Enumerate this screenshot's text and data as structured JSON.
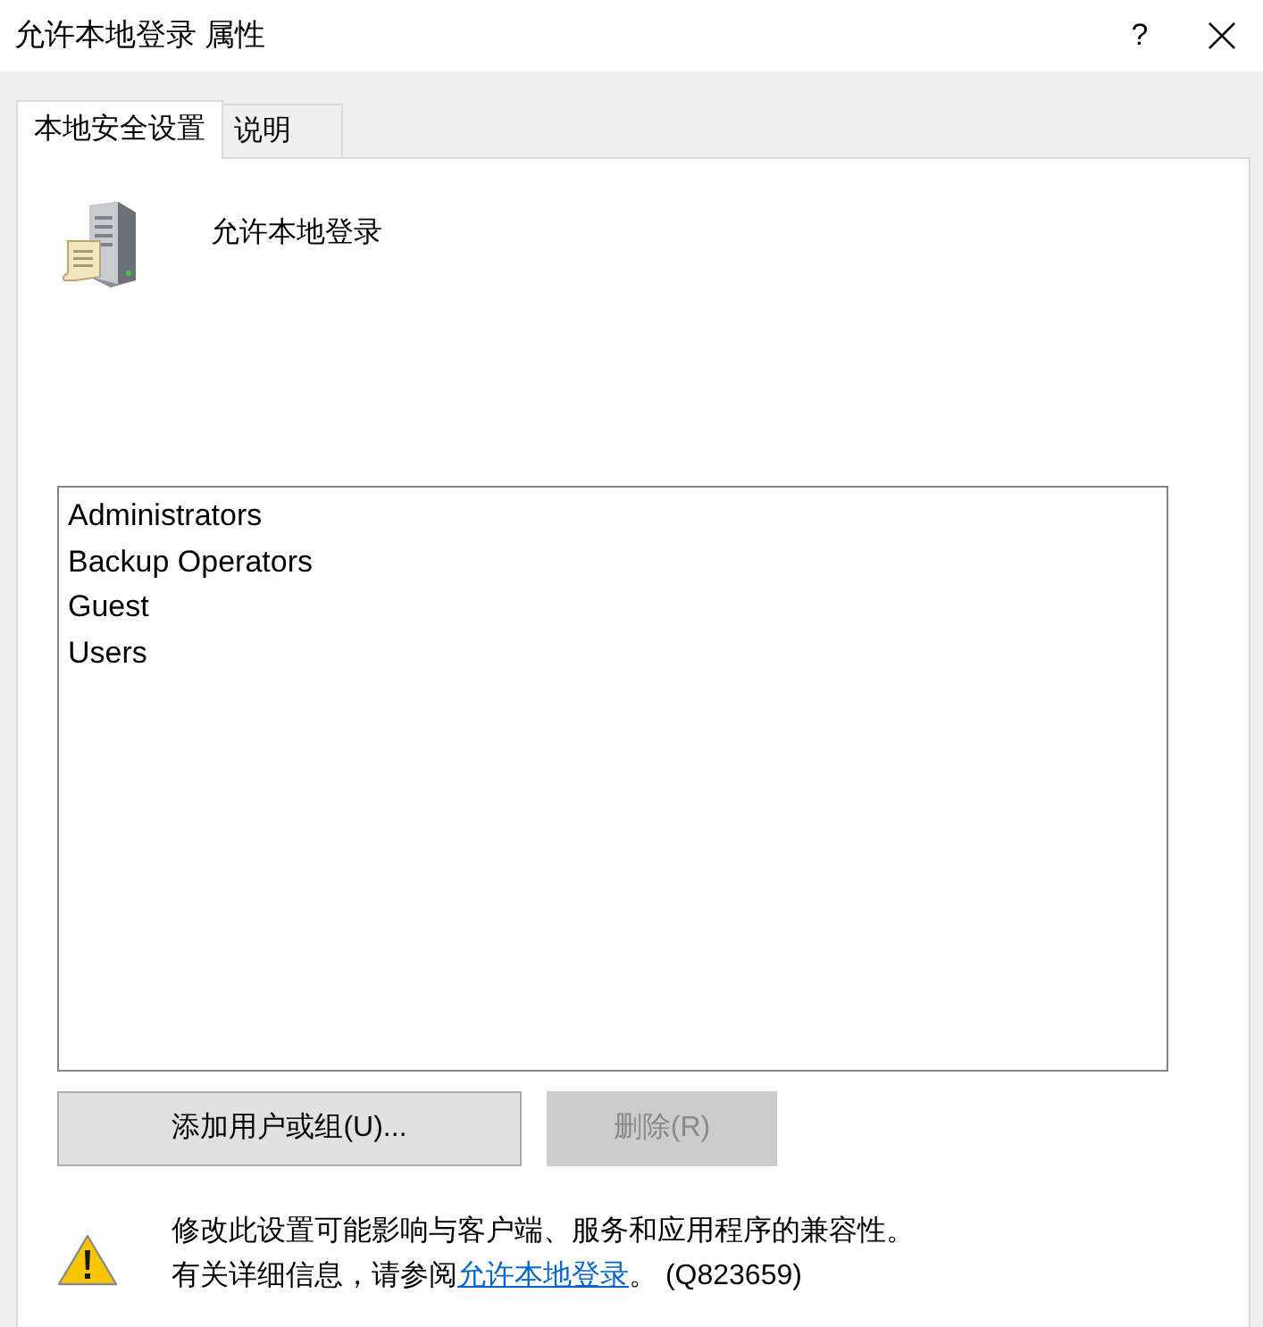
{
  "window": {
    "title": "允许本地登录 属性",
    "help": "?"
  },
  "tabs": [
    {
      "label": "本地安全设置",
      "selected": true
    },
    {
      "label": "说明",
      "selected": false
    }
  ],
  "policy": {
    "name": "允许本地登录"
  },
  "members": [
    {
      "name": "Administrators",
      "selected": false
    },
    {
      "name": "Backup Operators",
      "selected": false
    },
    {
      "name": "Guest",
      "selected": false
    },
    {
      "name": "Users",
      "selected": false
    }
  ],
  "buttons": [
    {
      "label": "添加用户或组(U)...",
      "disabled": false
    },
    {
      "label": "删除(R)",
      "disabled": true
    }
  ],
  "warning": {
    "line_1": "修改此设置可能影响与客户端、服务和应用程序的兼容性。",
    "line_2_before": "有关详细信息，请参阅",
    "link": "允许本地登录",
    "line_2_after": "。 (Q823659)"
  }
}
